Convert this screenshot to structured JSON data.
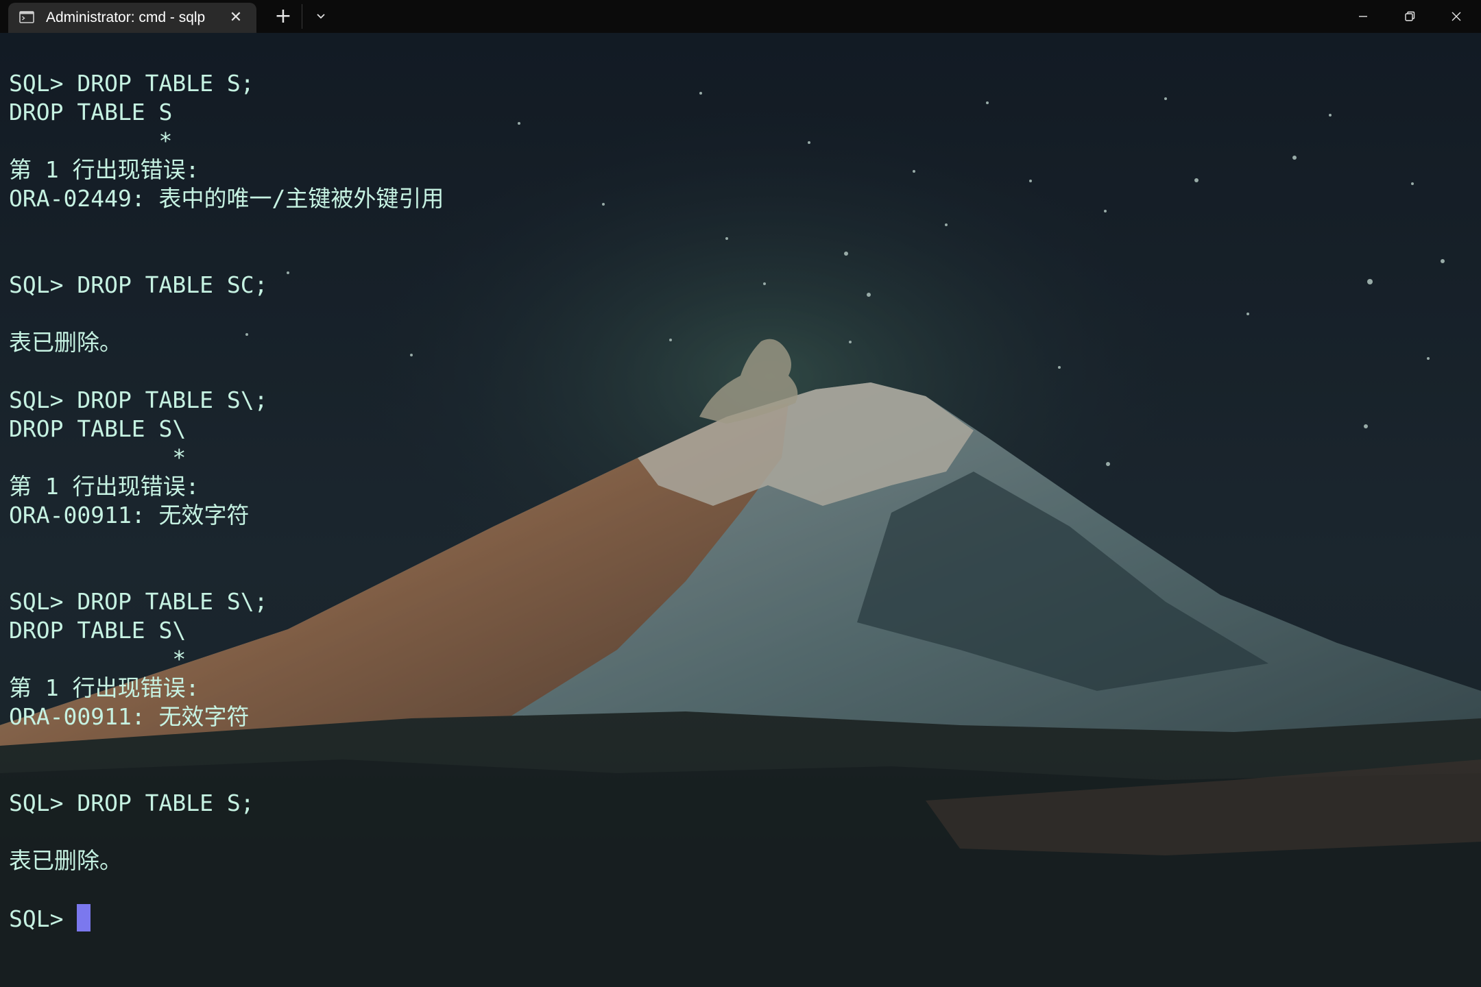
{
  "window": {
    "tab_title": "Administrator: cmd - sqlp",
    "tab_icon": "terminal-icon",
    "close_tab_glyph": "✕",
    "new_tab_glyph": "+",
    "dropdown_icon": "chevron-down-icon"
  },
  "colors": {
    "terminal_text": "#c6f2e2",
    "cursor": "#7b78ee",
    "titlebar": "#0b0b0b",
    "tab_active": "#2a2a2a"
  },
  "console": {
    "lines": [
      "SQL> DROP TABLE S;",
      "DROP TABLE S",
      "           *",
      "第 1 行出现错误:",
      "ORA-02449: 表中的唯一/主键被外键引用",
      "",
      "",
      "SQL> DROP TABLE SC;",
      "",
      "表已删除。",
      "",
      "SQL> DROP TABLE S\\;",
      "DROP TABLE S\\",
      "            *",
      "第 1 行出现错误:",
      "ORA-00911: 无效字符",
      "",
      "",
      "SQL> DROP TABLE S\\;",
      "DROP TABLE S\\",
      "            *",
      "第 1 行出现错误:",
      "ORA-00911: 无效字符",
      "",
      "",
      "SQL> DROP TABLE S;",
      "",
      "表已删除。",
      ""
    ],
    "prompt": "SQL> "
  }
}
